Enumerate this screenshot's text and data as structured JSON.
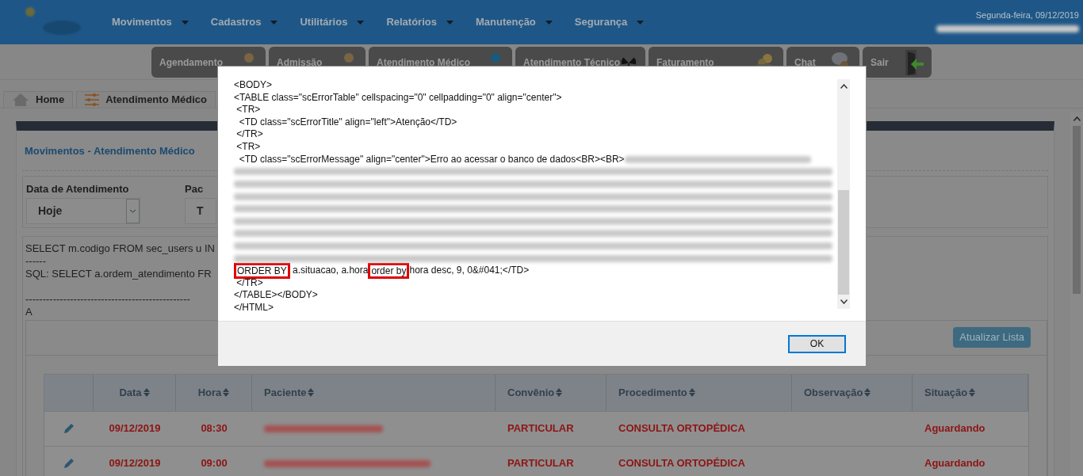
{
  "header": {
    "menu": [
      "Movimentos",
      "Cadastros",
      "Utilitários",
      "Relatórios",
      "Manutenção",
      "Segurança"
    ],
    "date": "Segunda-feira, 09/12/2019"
  },
  "shortcuts": [
    "Agendamento",
    "Admissão",
    "Atendimento Médico",
    "Atendimento Técnico",
    "Faturamento",
    "Chat",
    "Sair"
  ],
  "tabs": [
    "Home",
    "Atendimento Médico"
  ],
  "panel": {
    "title": "Movimentos - Atendimento Médico",
    "filters": [
      {
        "label": "Data de Atendimento",
        "value": "Hoje"
      },
      {
        "label": "Pac",
        "value": "T"
      }
    ],
    "error_lines": [
      "SELECT m.codigo FROM sec_users u IN",
      "------",
      "SQL: SELECT a.ordem_atendimento FR",
      "------------------------------------------------",
      "A"
    ],
    "refresh_button": "Atualizar Lista"
  },
  "table": {
    "columns": [
      "Data",
      "Hora",
      "Paciente",
      "Convênio",
      "Procedimento",
      "Observação",
      "Situação"
    ],
    "rows": [
      {
        "date": "09/12/2019",
        "time": "08:30",
        "insurance": "PARTICULAR",
        "procedure": "CONSULTA ORTOPÉDICA",
        "status": "Aguardando"
      },
      {
        "date": "09/12/2019",
        "time": "09:00",
        "insurance": "PARTICULAR",
        "procedure": "CONSULTA ORTOPÉDICA",
        "status": "Aguardando"
      }
    ]
  },
  "dialog": {
    "lines": [
      {
        "kind": "text",
        "text": "<BODY>"
      },
      {
        "kind": "text",
        "text": "<TABLE class=\"scErrorTable\" cellspacing=\"0\" cellpadding=\"0\" align=\"center\">"
      },
      {
        "kind": "text",
        "text": " <TR>"
      },
      {
        "kind": "text",
        "text": "  <TD class=\"scErrorTitle\" align=\"left\">Atenção</TD>"
      },
      {
        "kind": "text",
        "text": " </TR>"
      },
      {
        "kind": "text",
        "text": " <TR>"
      },
      {
        "kind": "text",
        "text": "  <TD class=\"scErrorMessage\" align=\"center\">Erro ao acessar o banco de dados<BR><BR>",
        "redacted_tail": true
      },
      {
        "kind": "redacted"
      },
      {
        "kind": "redacted"
      },
      {
        "kind": "redacted"
      },
      {
        "kind": "redacted"
      },
      {
        "kind": "redacted"
      },
      {
        "kind": "redacted"
      },
      {
        "kind": "redacted"
      },
      {
        "kind": "redacted"
      },
      {
        "kind": "segments",
        "segments": [
          {
            "text": "ORDER BY",
            "marked": true
          },
          {
            "text": " a.situacao, a.hora",
            "marked": false
          },
          {
            "text": "order by",
            "marked": true
          },
          {
            "text": "hora desc, 9, 0&#041;</TD>",
            "marked": false
          }
        ]
      },
      {
        "kind": "text",
        "text": " </TR>"
      },
      {
        "kind": "text",
        "text": "</TABLE></BODY>"
      },
      {
        "kind": "text",
        "text": "</HTML>"
      }
    ],
    "ok_button": "OK"
  }
}
